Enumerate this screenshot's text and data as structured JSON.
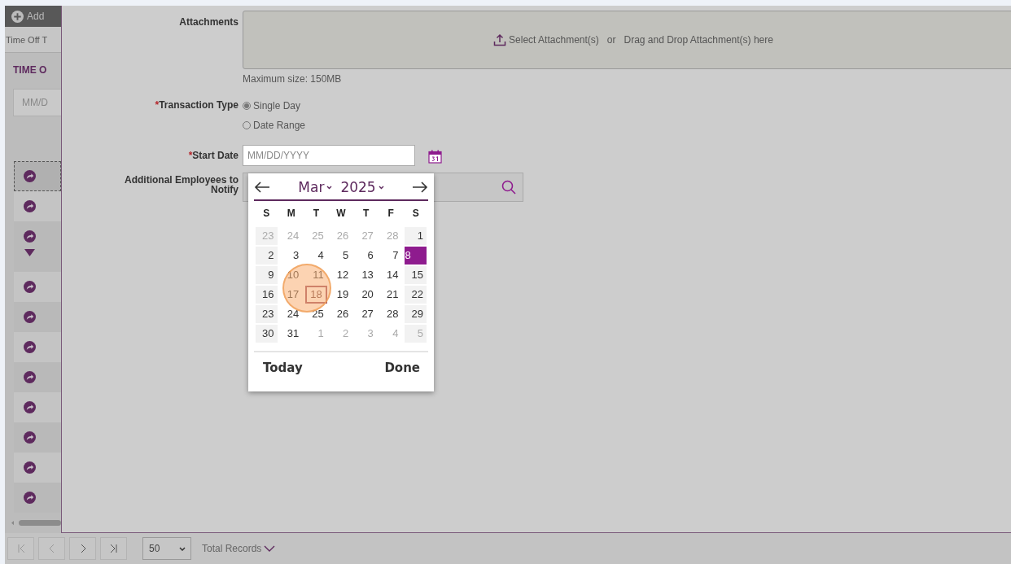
{
  "background_page": {
    "add_button": "Add",
    "tab": "Time Off T",
    "section_title": "TIME O",
    "date_field": {
      "placeholder": "MM/D"
    },
    "rows": [
      {
        "focused": true,
        "expanded": false
      },
      {
        "focused": false,
        "expanded": false
      },
      {
        "focused": false,
        "expanded": true
      },
      {
        "focused": false,
        "expanded": false
      },
      {
        "focused": false,
        "expanded": false
      },
      {
        "focused": false,
        "expanded": false
      },
      {
        "focused": false,
        "expanded": false
      },
      {
        "focused": false,
        "expanded": false
      },
      {
        "focused": false,
        "expanded": false
      },
      {
        "focused": false,
        "expanded": false
      },
      {
        "focused": false,
        "expanded": false
      }
    ],
    "pagination": {
      "page_size": "50",
      "total_label": "Total Records"
    }
  },
  "form": {
    "attachments": {
      "label": "Attachments",
      "select_link": "Select Attachment(s)",
      "or": "or",
      "drop_hint": "Drag and Drop Attachment(s) here",
      "max_size": "Maximum size: 150MB"
    },
    "transaction_type": {
      "required_mark": "*",
      "label": "Transaction Type",
      "options": [
        {
          "label": "Single Day",
          "selected": true
        },
        {
          "label": "Date Range",
          "selected": false
        }
      ]
    },
    "start_date": {
      "required_mark": "*",
      "label": "Start Date",
      "placeholder": "MM/DD/YYYY"
    },
    "additional_employees": {
      "label": "Additional Employees to Notify"
    }
  },
  "calendar": {
    "month": "Mar",
    "year": "2025",
    "weekdays": [
      "S",
      "M",
      "T",
      "W",
      "T",
      "F",
      "S"
    ],
    "weeks": [
      [
        {
          "day": "23",
          "muted": true,
          "selected": false,
          "today": false
        },
        {
          "day": "24",
          "muted": true,
          "selected": false,
          "today": false
        },
        {
          "day": "25",
          "muted": true,
          "selected": false,
          "today": false
        },
        {
          "day": "26",
          "muted": true,
          "selected": false,
          "today": false
        },
        {
          "day": "27",
          "muted": true,
          "selected": false,
          "today": false
        },
        {
          "day": "28",
          "muted": true,
          "selected": false,
          "today": false
        },
        {
          "day": "1",
          "muted": false,
          "selected": false,
          "today": false
        }
      ],
      [
        {
          "day": "2",
          "muted": false,
          "selected": false,
          "today": false
        },
        {
          "day": "3",
          "muted": false,
          "selected": false,
          "today": false
        },
        {
          "day": "4",
          "muted": false,
          "selected": false,
          "today": false
        },
        {
          "day": "5",
          "muted": false,
          "selected": false,
          "today": false
        },
        {
          "day": "6",
          "muted": false,
          "selected": false,
          "today": false
        },
        {
          "day": "7",
          "muted": false,
          "selected": false,
          "today": false
        },
        {
          "day": "8",
          "muted": false,
          "selected": true,
          "today": false
        }
      ],
      [
        {
          "day": "9",
          "muted": false,
          "selected": false,
          "today": false
        },
        {
          "day": "10",
          "muted": false,
          "selected": false,
          "today": false
        },
        {
          "day": "11",
          "muted": false,
          "selected": false,
          "today": false
        },
        {
          "day": "12",
          "muted": false,
          "selected": false,
          "today": false
        },
        {
          "day": "13",
          "muted": false,
          "selected": false,
          "today": false
        },
        {
          "day": "14",
          "muted": false,
          "selected": false,
          "today": false
        },
        {
          "day": "15",
          "muted": false,
          "selected": false,
          "today": false
        }
      ],
      [
        {
          "day": "16",
          "muted": false,
          "selected": false,
          "today": false
        },
        {
          "day": "17",
          "muted": false,
          "selected": false,
          "today": false
        },
        {
          "day": "18",
          "muted": false,
          "selected": false,
          "today": true
        },
        {
          "day": "19",
          "muted": false,
          "selected": false,
          "today": false
        },
        {
          "day": "20",
          "muted": false,
          "selected": false,
          "today": false
        },
        {
          "day": "21",
          "muted": false,
          "selected": false,
          "today": false
        },
        {
          "day": "22",
          "muted": false,
          "selected": false,
          "today": false
        }
      ],
      [
        {
          "day": "23",
          "muted": false,
          "selected": false,
          "today": false
        },
        {
          "day": "24",
          "muted": false,
          "selected": false,
          "today": false
        },
        {
          "day": "25",
          "muted": false,
          "selected": false,
          "today": false
        },
        {
          "day": "26",
          "muted": false,
          "selected": false,
          "today": false
        },
        {
          "day": "27",
          "muted": false,
          "selected": false,
          "today": false
        },
        {
          "day": "28",
          "muted": false,
          "selected": false,
          "today": false
        },
        {
          "day": "29",
          "muted": false,
          "selected": false,
          "today": false
        }
      ],
      [
        {
          "day": "30",
          "muted": false,
          "selected": false,
          "today": false
        },
        {
          "day": "31",
          "muted": false,
          "selected": false,
          "today": false
        },
        {
          "day": "1",
          "muted": true,
          "selected": false,
          "today": false
        },
        {
          "day": "2",
          "muted": true,
          "selected": false,
          "today": false
        },
        {
          "day": "3",
          "muted": true,
          "selected": false,
          "today": false
        },
        {
          "day": "4",
          "muted": true,
          "selected": false,
          "today": false
        },
        {
          "day": "5",
          "muted": true,
          "selected": false,
          "today": false
        }
      ]
    ],
    "today_button": "Today",
    "done_button": "Done"
  }
}
